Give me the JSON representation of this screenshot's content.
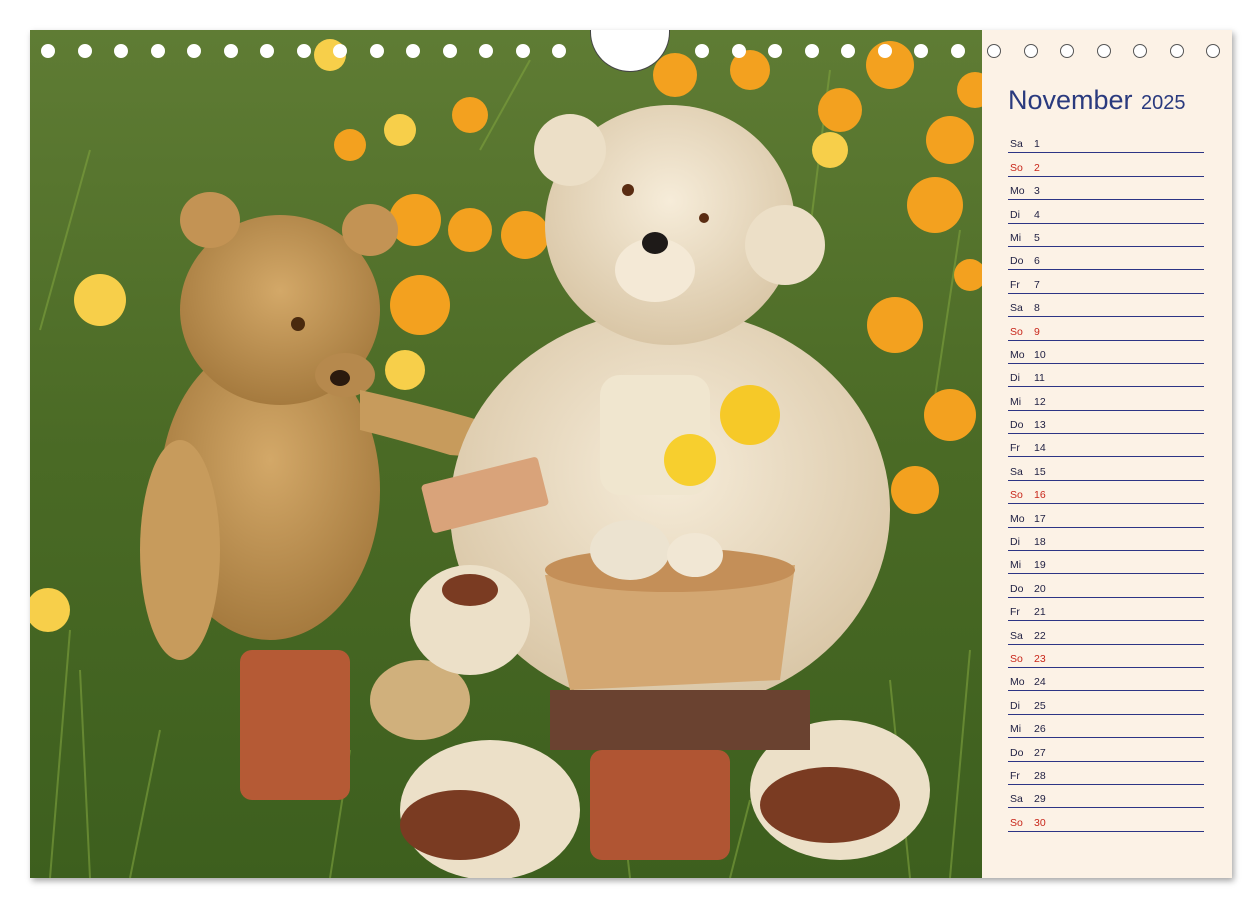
{
  "calendar": {
    "month": "November",
    "year": "2025",
    "days": [
      {
        "dw": "Sa",
        "dn": "1",
        "sunday": false
      },
      {
        "dw": "So",
        "dn": "2",
        "sunday": true
      },
      {
        "dw": "Mo",
        "dn": "3",
        "sunday": false
      },
      {
        "dw": "Di",
        "dn": "4",
        "sunday": false
      },
      {
        "dw": "Mi",
        "dn": "5",
        "sunday": false
      },
      {
        "dw": "Do",
        "dn": "6",
        "sunday": false
      },
      {
        "dw": "Fr",
        "dn": "7",
        "sunday": false
      },
      {
        "dw": "Sa",
        "dn": "8",
        "sunday": false
      },
      {
        "dw": "So",
        "dn": "9",
        "sunday": true
      },
      {
        "dw": "Mo",
        "dn": "10",
        "sunday": false
      },
      {
        "dw": "Di",
        "dn": "11",
        "sunday": false
      },
      {
        "dw": "Mi",
        "dn": "12",
        "sunday": false
      },
      {
        "dw": "Do",
        "dn": "13",
        "sunday": false
      },
      {
        "dw": "Fr",
        "dn": "14",
        "sunday": false
      },
      {
        "dw": "Sa",
        "dn": "15",
        "sunday": false
      },
      {
        "dw": "So",
        "dn": "16",
        "sunday": true
      },
      {
        "dw": "Mo",
        "dn": "17",
        "sunday": false
      },
      {
        "dw": "Di",
        "dn": "18",
        "sunday": false
      },
      {
        "dw": "Mi",
        "dn": "19",
        "sunday": false
      },
      {
        "dw": "Do",
        "dn": "20",
        "sunday": false
      },
      {
        "dw": "Fr",
        "dn": "21",
        "sunday": false
      },
      {
        "dw": "Sa",
        "dn": "22",
        "sunday": false
      },
      {
        "dw": "So",
        "dn": "23",
        "sunday": true
      },
      {
        "dw": "Mo",
        "dn": "24",
        "sunday": false
      },
      {
        "dw": "Di",
        "dn": "25",
        "sunday": false
      },
      {
        "dw": "Mi",
        "dn": "26",
        "sunday": false
      },
      {
        "dw": "Do",
        "dn": "27",
        "sunday": false
      },
      {
        "dw": "Fr",
        "dn": "28",
        "sunday": false
      },
      {
        "dw": "Sa",
        "dn": "29",
        "sunday": false
      },
      {
        "dw": "So",
        "dn": "30",
        "sunday": true
      }
    ]
  },
  "colors": {
    "title": "#2a3a7e",
    "rule": "#2d3585",
    "sunday": "#c8261a",
    "panel_bg": "#fcf2e6"
  }
}
